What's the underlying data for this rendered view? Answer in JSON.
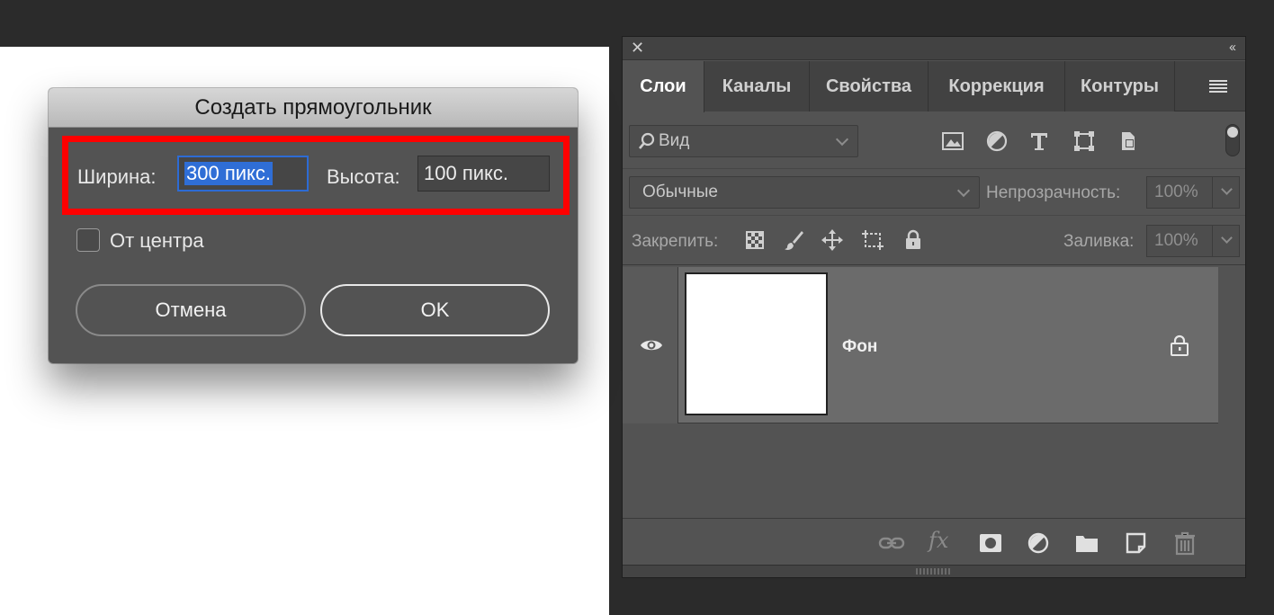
{
  "dialog": {
    "title": "Создать прямоугольник",
    "width_label": "Ширина:",
    "width_value": "300 пикс.",
    "height_label": "Высота:",
    "height_value": "100 пикс.",
    "from_center_label": "От центра",
    "from_center_checked": false,
    "cancel_label": "Отмена",
    "ok_label": "OK",
    "highlight_color": "#ff0000",
    "selection_color": "#2f6ed6"
  },
  "panel": {
    "tabs": [
      {
        "label": "Слои",
        "active": true
      },
      {
        "label": "Каналы",
        "active": false
      },
      {
        "label": "Свойства",
        "active": false
      },
      {
        "label": "Коррекция",
        "active": false
      },
      {
        "label": "Контуры",
        "active": false
      }
    ],
    "filter": {
      "placeholder": "Вид"
    },
    "blend_mode": "Обычные",
    "opacity_label": "Непрозрачность:",
    "opacity_value": "100%",
    "lock_label": "Закрепить:",
    "fill_label": "Заливка:",
    "fill_value": "100%",
    "layers": [
      {
        "name": "Фон",
        "visible": true,
        "locked": true
      }
    ],
    "footer_icons": [
      "link-icon",
      "fx-icon",
      "mask-icon",
      "adjustment-icon",
      "folder-icon",
      "new-layer-icon",
      "trash-icon"
    ],
    "fx_text": "fx"
  }
}
